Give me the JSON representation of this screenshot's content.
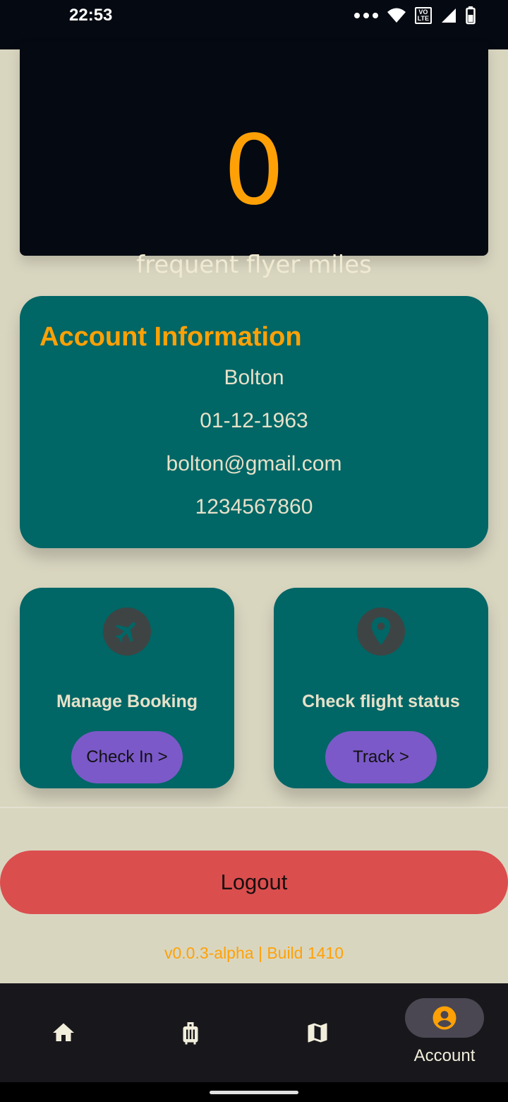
{
  "status_bar": {
    "time": "22:53",
    "network_badge": [
      "VO",
      "LTE"
    ],
    "icons": [
      "more-dots-icon",
      "wifi-icon",
      "volte-icon",
      "signal-icon",
      "battery-icon"
    ]
  },
  "miles": {
    "value": "0",
    "label": "frequent flyer miles"
  },
  "account": {
    "title": "Account Information",
    "name": "Bolton",
    "dob": "01-12-1963",
    "email": "bolton@gmail.com",
    "phone": "1234567860"
  },
  "actions": [
    {
      "title": "Manage Booking",
      "button": "Check In >",
      "icon": "airplane-icon"
    },
    {
      "title": "Check flight status",
      "button": "Track >",
      "icon": "map-pin-icon"
    }
  ],
  "logout_label": "Logout",
  "version": "v0.0.3-alpha | Build 1410",
  "nav": {
    "items": [
      {
        "icon": "home-icon"
      },
      {
        "icon": "luggage-icon"
      },
      {
        "icon": "map-icon"
      },
      {
        "icon": "account-icon",
        "label": "Account",
        "active": true
      }
    ]
  },
  "colors": {
    "accent": "#ffa106",
    "teal": "#006666",
    "purple": "#7b59c8",
    "logout": "#db4e4e",
    "background": "#d9d6c0"
  }
}
